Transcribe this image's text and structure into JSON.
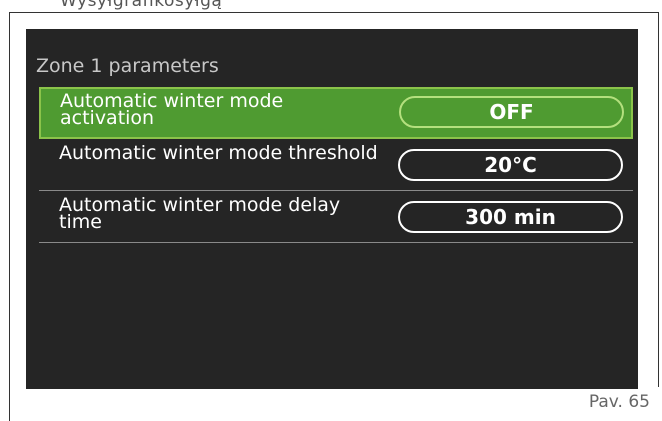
{
  "top_text": "Wysyłgrafikosyłgą",
  "screen": {
    "title": "Zone 1 parameters",
    "rows": [
      {
        "label": "Automatic winter mode activation",
        "value": "OFF",
        "selected": true
      },
      {
        "label": "Automatic winter mode threshold",
        "value": "20°C",
        "selected": false
      },
      {
        "label": "Automatic winter mode delay time",
        "value": "300 min",
        "selected": false
      }
    ]
  },
  "caption": "Pav. 65",
  "colors": {
    "screen_bg": "#252525",
    "selection_bg": "#4f9b31",
    "selection_border": "#8bc34a"
  }
}
